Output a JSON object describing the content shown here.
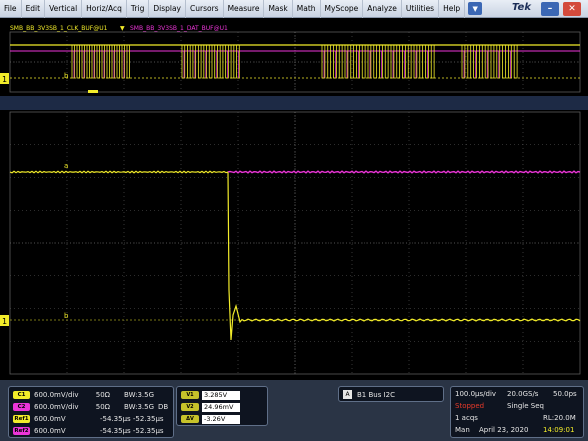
{
  "menu": {
    "items": [
      "File",
      "Edit",
      "Vertical",
      "Horiz/Acq",
      "Trig",
      "Display",
      "Cursors",
      "Measure",
      "Mask",
      "Math",
      "MyScope",
      "Analyze",
      "Utilities",
      "Help"
    ],
    "dropdown_icon": "chevron-down-icon",
    "brand": "Tek",
    "minimize_icon": "minimize-icon",
    "close_icon": "close-icon"
  },
  "overview": {
    "label_clk": "SMB_BB_3V3SB_1_CLK_BUF@U1",
    "label_dat": "SMB_BB_3V3SB_1_DAT_BUF@U1",
    "ref_marker": "b",
    "ch_marker": "1"
  },
  "main": {
    "ref_marker_top": "a",
    "ref_marker_bottom": "b",
    "ch_marker": "1"
  },
  "channels": [
    {
      "badge": "C1",
      "scale": "600.0mV/div",
      "impedance": "50Ω",
      "bw": "BW:3.5G",
      "color": "#f2ec2a"
    },
    {
      "badge": "C2",
      "scale": "600.0mV/div",
      "impedance": "50Ω",
      "bw": "BW:3.5G",
      "suffix": "DB",
      "color": "#ec35d8"
    },
    {
      "badge": "Ref1",
      "scale": "600.0mV",
      "offset": "-54.35µs -52.35µs",
      "color": "#f2ec2a"
    },
    {
      "badge": "Ref2",
      "scale": "600.0mV",
      "offset": "-54.35µs -52.35µs",
      "color": "#ec35d8"
    }
  ],
  "cursors": [
    {
      "badge": "V1",
      "value": "3.285V"
    },
    {
      "badge": "V2",
      "value": "24.96mV"
    },
    {
      "badge": "ΔV",
      "value": "-3.26V"
    }
  ],
  "bus": {
    "badge": "A",
    "label": "B1 Bus I2C"
  },
  "horizontal": {
    "time_div": "100.0µs/div",
    "sample_rate": "20.0GS/s",
    "ps_pt": "50.0ps",
    "status": "Stopped",
    "seq": "Single Seq",
    "acqs": "1 acqs",
    "record_length": "RL:20.0M",
    "mode": "Man",
    "date": "April 23, 2020",
    "time": "14:09:01"
  },
  "colors": {
    "ch1": "#f2ec2a",
    "ch2": "#ec35d8",
    "grid": "#5a5a5a",
    "status_stopped": "#e83a2a",
    "time_text": "#f2ec2a"
  }
}
